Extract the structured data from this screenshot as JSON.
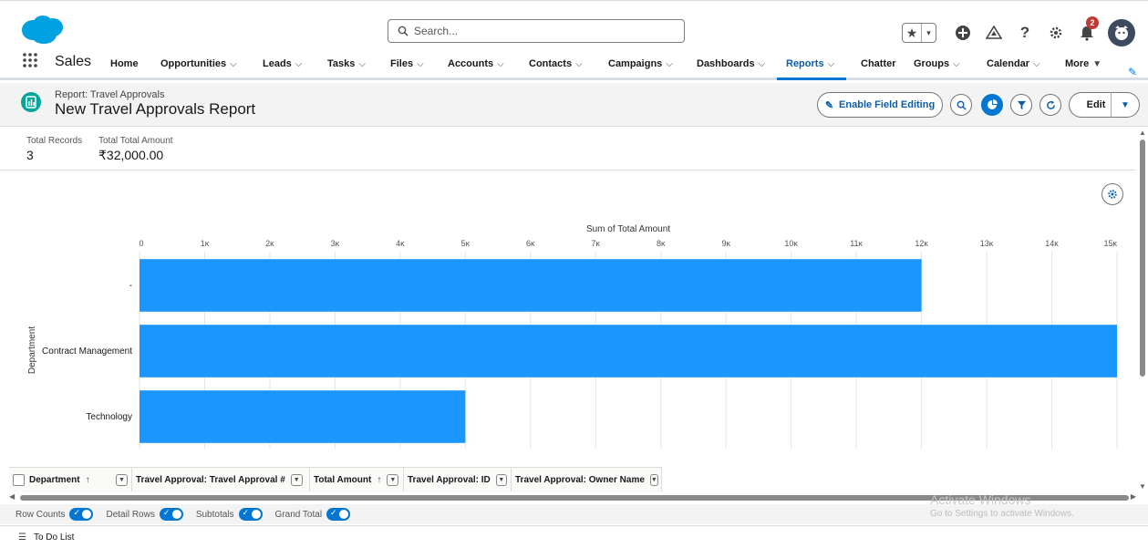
{
  "header": {
    "search_placeholder": "Search...",
    "notification_count": "2",
    "icons": [
      "salesforce-cloud-logo",
      "search-icon",
      "star-icon",
      "add-icon",
      "trailhead-icon",
      "help-icon",
      "gear-icon",
      "bell-icon",
      "avatar"
    ]
  },
  "app": {
    "name": "Sales",
    "nav_items": [
      {
        "label": "Home",
        "has_menu": false
      },
      {
        "label": "Opportunities",
        "has_menu": true
      },
      {
        "label": "Leads",
        "has_menu": true
      },
      {
        "label": "Tasks",
        "has_menu": true
      },
      {
        "label": "Files",
        "has_menu": true
      },
      {
        "label": "Accounts",
        "has_menu": true
      },
      {
        "label": "Contacts",
        "has_menu": true
      },
      {
        "label": "Campaigns",
        "has_menu": true
      },
      {
        "label": "Dashboards",
        "has_menu": true
      },
      {
        "label": "Reports",
        "has_menu": true,
        "active": true
      },
      {
        "label": "Chatter",
        "has_menu": false
      },
      {
        "label": "Groups",
        "has_menu": true
      },
      {
        "label": "Calendar",
        "has_menu": true
      },
      {
        "label": "More",
        "has_menu": true
      }
    ]
  },
  "page_header": {
    "subtitle": "Report: Travel Approvals",
    "title": "New Travel Approvals Report",
    "enable_field_editing": "Enable Field Editing",
    "edit": "Edit"
  },
  "summary": {
    "total_records_label": "Total Records",
    "total_records_value": "3",
    "total_amount_label": "Total Total Amount",
    "total_amount_value": "₹32,000.00"
  },
  "chart_data": {
    "type": "bar",
    "orientation": "horizontal",
    "title": "Sum of Total Amount",
    "ylabel": "Department",
    "categories": [
      "-",
      "Contract Management",
      "Technology"
    ],
    "values": [
      12000,
      15000,
      5000
    ],
    "x_ticks": [
      "0",
      "1ĸ",
      "2ĸ",
      "3ĸ",
      "4ĸ",
      "5ĸ",
      "6ĸ",
      "7ĸ",
      "8ĸ",
      "9ĸ",
      "10ĸ",
      "11ĸ",
      "12ĸ",
      "13ĸ",
      "14ĸ",
      "15ĸ"
    ],
    "xlim": [
      0,
      15000
    ],
    "bar_color": "#1b96ff",
    "grid": true
  },
  "table": {
    "columns": [
      {
        "label": "Department",
        "sort": "↑"
      },
      {
        "label": "Travel Approval: Travel Approval #",
        "sort": ""
      },
      {
        "label": "Total Amount",
        "sort": "↑"
      },
      {
        "label": "Travel Approval: ID",
        "sort": ""
      },
      {
        "label": "Travel Approval: Owner Name",
        "sort": ""
      }
    ]
  },
  "toggles": [
    {
      "label": "Row Counts",
      "on": true
    },
    {
      "label": "Detail Rows",
      "on": true
    },
    {
      "label": "Subtotals",
      "on": true
    },
    {
      "label": "Grand Total",
      "on": true
    }
  ],
  "watermark": {
    "line1": "Activate Windows",
    "line2": "Go to Settings to activate Windows."
  },
  "utility_bar": {
    "to_do_list": "To Do List"
  },
  "colors": {
    "brand_blue": "#0176d3",
    "bar_blue": "#1b96ff",
    "report_icon": "#06a59a",
    "badge_red": "#c23934"
  }
}
